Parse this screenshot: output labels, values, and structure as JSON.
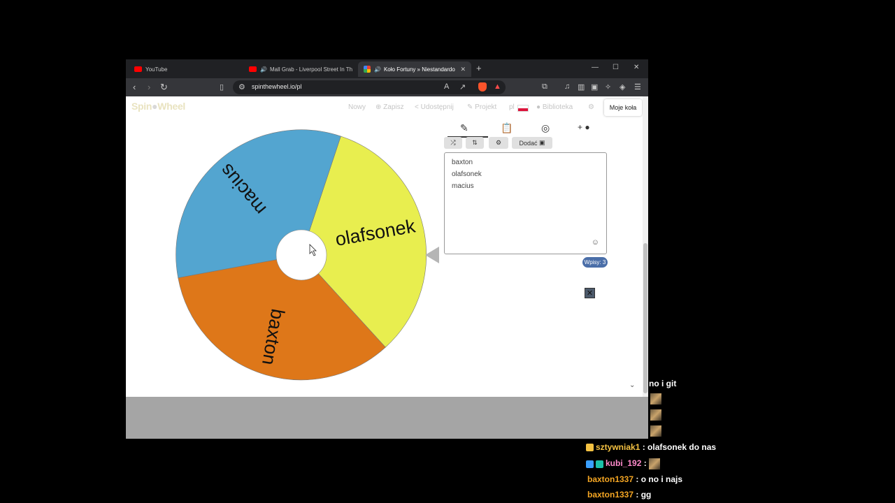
{
  "browser": {
    "tabs": [
      {
        "title": "YouTube"
      },
      {
        "title": "Mall Grab - Liverpool Street In Th"
      },
      {
        "title": "Koło Fortuny » Niestandardo"
      }
    ],
    "url": "spinthewheel.io/pl"
  },
  "site": {
    "logo_prefix": "Spin",
    "logo_suffix": "Wheel",
    "menu": {
      "new": "Nowy",
      "save": "Zapisz",
      "share": "Udostępnij",
      "project": "Projekt",
      "lang": "pl",
      "library": "Biblioteka",
      "my_wheels": "Moje koła"
    },
    "add_button": "Dodać",
    "entries": [
      "baxton",
      "olafsonek",
      "macius"
    ],
    "entries_count": "Wpisy: 3"
  },
  "wheel": {
    "segments": [
      {
        "label": "olafsonek",
        "color": "#e8ee4f"
      },
      {
        "label": "baxton",
        "color": "#de7719"
      },
      {
        "label": "macius",
        "color": "#53a5d0"
      }
    ]
  },
  "chat": {
    "messages": [
      {
        "user": "",
        "text": "no i git"
      },
      {
        "user": "sztywniak1",
        "sep": " : ",
        "text": "olafsonek do nas",
        "color": "#f5c242"
      },
      {
        "user": "kubi_192",
        "sep": " : ",
        "text": "",
        "color": "#ff8acb"
      },
      {
        "user": "baxton1337",
        "sep": " : ",
        "text": "o no i najs",
        "color": "#f5a623"
      },
      {
        "user": "baxton1337",
        "sep": " : ",
        "text": "gg",
        "color": "#f5a623"
      }
    ]
  }
}
